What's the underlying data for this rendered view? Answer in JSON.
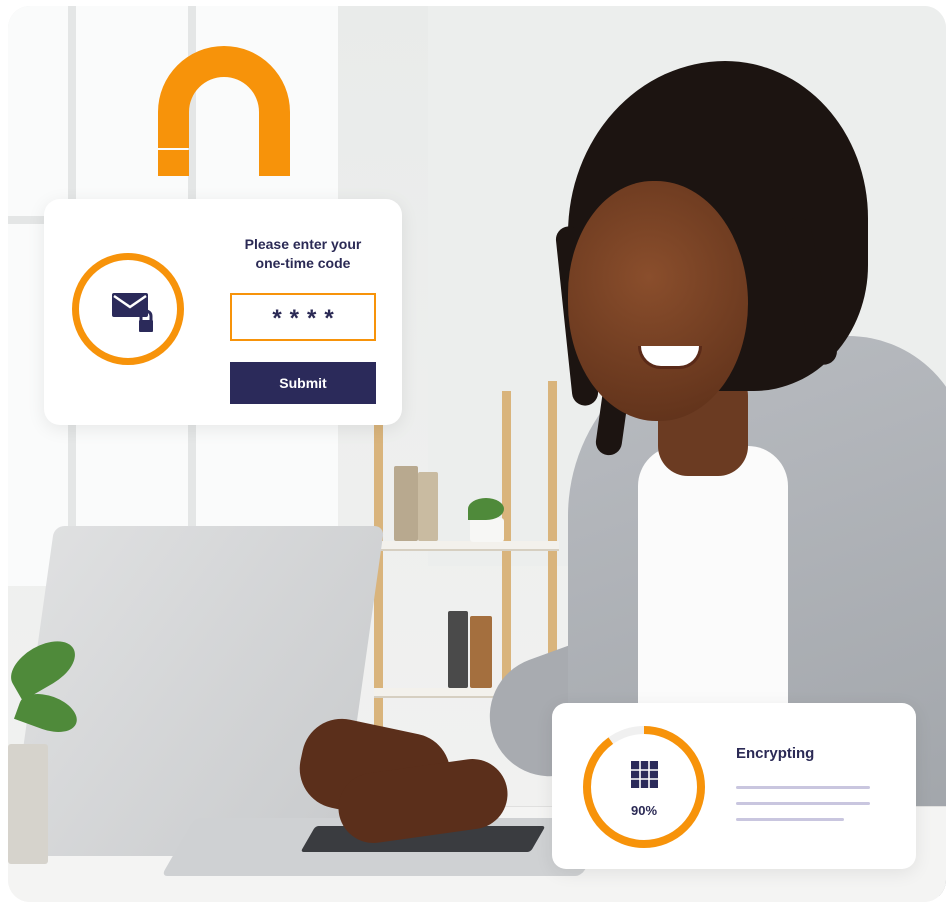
{
  "otp_card": {
    "title": "Please enter your one-time code",
    "code_value": "****",
    "submit_label": "Submit",
    "icon": "mail-lock-icon"
  },
  "encrypt_card": {
    "title": "Encrypting",
    "progress_label": "90%",
    "progress": 0.9,
    "icon": "grid-icon"
  },
  "colors": {
    "accent": "#f7930a",
    "navy": "#2b2a5a",
    "line": "#c9c6df"
  }
}
